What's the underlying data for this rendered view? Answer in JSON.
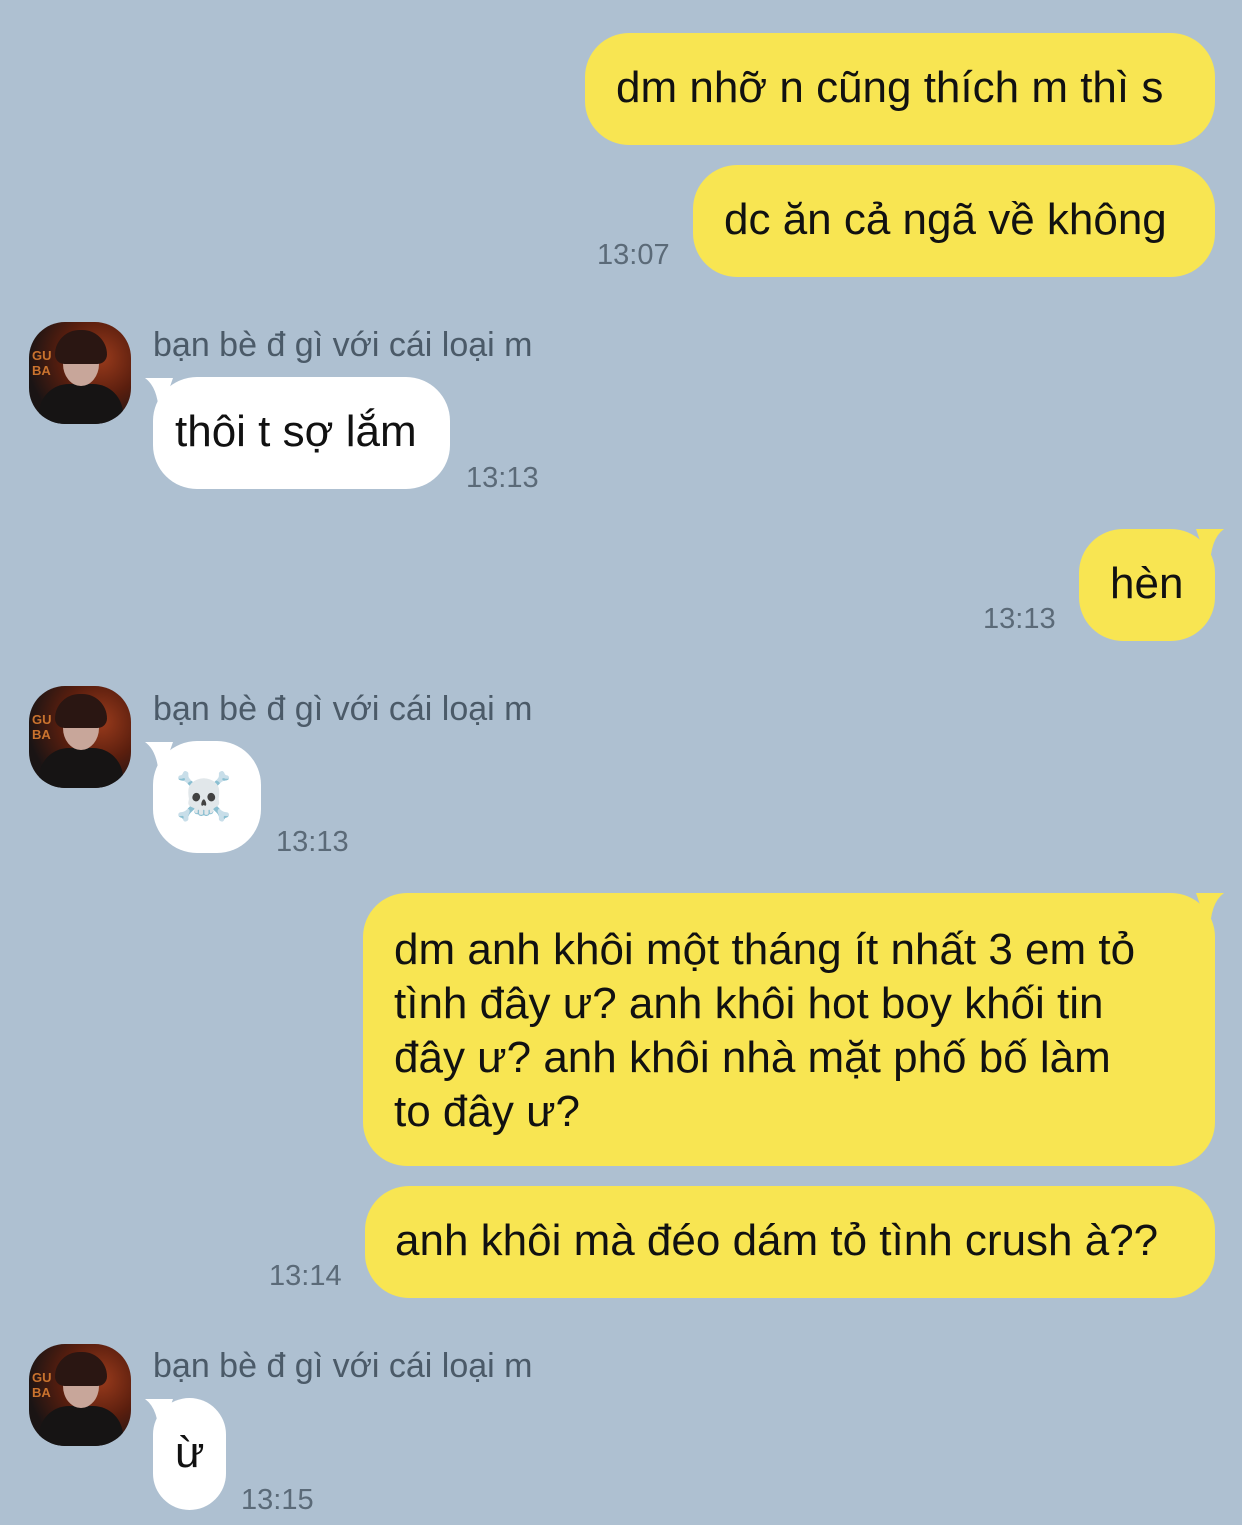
{
  "contact": {
    "name": "bạn bè đ gì với cái loại m"
  },
  "messages": [
    {
      "id": "m1",
      "from": "me",
      "text": "dm nhỡ n cũng thích m thì s"
    },
    {
      "id": "m2",
      "from": "me",
      "text": "dc ăn cả ngã về không",
      "time": "13:07"
    },
    {
      "id": "m3",
      "from": "them",
      "sender": "bạn bè đ gì với cái loại m",
      "text": "thôi t sợ lắm",
      "time": "13:13"
    },
    {
      "id": "m4",
      "from": "me",
      "text": "hèn",
      "time": "13:13"
    },
    {
      "id": "m5",
      "from": "them",
      "sender": "bạn bè đ gì với cái loại m",
      "text": "☠️",
      "time": "13:13"
    },
    {
      "id": "m6",
      "from": "me",
      "text": "dm anh khôi một tháng ít nhất 3 em tỏ\ntình đây ư? anh khôi hot boy khối tin\nđây ư? anh khôi nhà mặt phố bố làm\nto đây ư?"
    },
    {
      "id": "m7",
      "from": "me",
      "text": "anh khôi mà đéo dám tỏ tình crush à??",
      "time": "13:14"
    },
    {
      "id": "m8",
      "from": "them",
      "sender": "bạn bè đ gì với cái loại m",
      "text": "ừ",
      "time": "13:15"
    }
  ],
  "avatar_text": "GU\nBA",
  "colors": {
    "background": "#aec0d1",
    "sent_bubble": "#f8e552",
    "received_bubble": "#ffffff",
    "timestamp": "#5b6a78"
  }
}
